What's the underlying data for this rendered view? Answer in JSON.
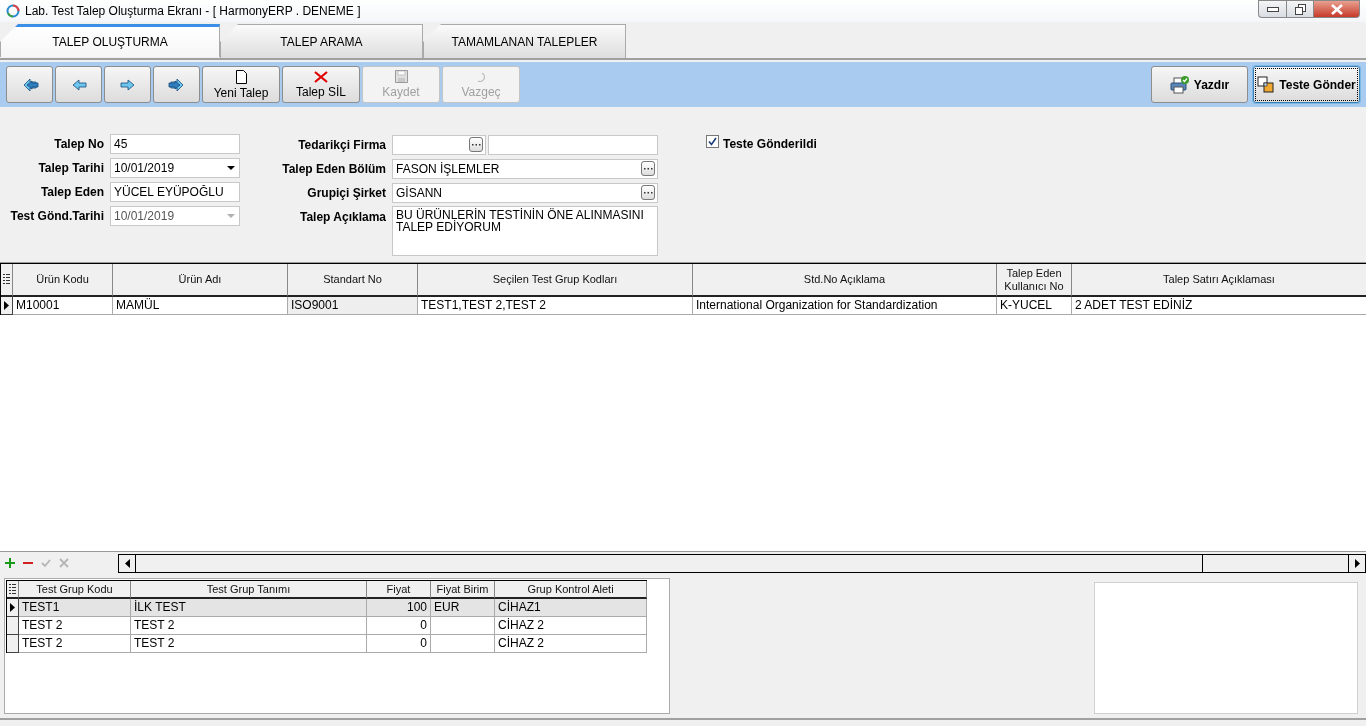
{
  "window": {
    "title": "Lab. Test Talep Oluşturma Ekranı - [ HarmonyERP . DENEME ]"
  },
  "tabs": [
    {
      "label": "TALEP OLUŞTURMA",
      "selected": true
    },
    {
      "label": "TALEP ARAMA",
      "selected": false
    },
    {
      "label": "TAMAMLANAN TALEPLER",
      "selected": false
    }
  ],
  "toolbar": {
    "buttons": [
      {
        "kind": "first",
        "disabled": false
      },
      {
        "kind": "prev",
        "disabled": false
      },
      {
        "kind": "next",
        "disabled": false
      },
      {
        "kind": "last",
        "disabled": false
      },
      {
        "kind": "new",
        "label": "Yeni Talep",
        "disabled": false
      },
      {
        "kind": "delete",
        "label": "Talep SİL",
        "disabled": false
      },
      {
        "kind": "save",
        "label": "Kaydet",
        "disabled": true
      },
      {
        "kind": "cancel",
        "label": "Vazgeç",
        "disabled": true
      }
    ],
    "right_buttons": [
      {
        "kind": "print",
        "label": "Yazdır",
        "focused": false
      },
      {
        "kind": "send",
        "label": "Teste Gönder",
        "focused": true
      }
    ]
  },
  "form": {
    "left_fields": [
      {
        "kind": "text",
        "label": "Talep No",
        "value": "45"
      },
      {
        "kind": "date",
        "label": "Talep Tarihi",
        "value": "10/01/2019",
        "disabled": false
      },
      {
        "kind": "text",
        "label": "Talep Eden",
        "value": "YÜCEL EYÜPOĞLU"
      },
      {
        "kind": "date",
        "label": "Test Gönd.Tarihi",
        "value": "10/01/2019",
        "disabled": true
      }
    ],
    "right_fields": [
      {
        "kind": "split_lookup",
        "label": "Tedarikçi Firma"
      },
      {
        "kind": "lookup",
        "label": "Talep Eden Bölüm",
        "value": "FASON İŞLEMLER"
      },
      {
        "kind": "lookup",
        "label": "Grupiçi Şirket",
        "value": "GİSANN"
      },
      {
        "kind": "memo",
        "label": "Talep Açıklama",
        "value": "BU ÜRÜNLERİN TESTİNİN ÖNE ALINMASINI TALEP EDİYORUM"
      }
    ],
    "checkbox": {
      "label": "Teste Gönderildi",
      "checked": true
    }
  },
  "grid1": {
    "columns": [
      {
        "label": "Ürün Kodu",
        "shaded": false
      },
      {
        "label": "Ürün Adı",
        "shaded": false
      },
      {
        "label": "Standart No",
        "shaded": true
      },
      {
        "label": "Seçilen Test Grup Kodları",
        "shaded": false
      },
      {
        "label": "Std.No Açıklama",
        "shaded": false
      },
      {
        "label": "Talep Eden Kullanıcı No",
        "shaded": false
      },
      {
        "label": "Talep Satırı Açıklaması",
        "shaded": false
      }
    ],
    "rows": [
      {
        "current": true,
        "selected": false,
        "cells": [
          "M10001",
          "MAMÜL",
          "ISO9001",
          "TEST1,TEST 2,TEST 2",
          "International Organization for Standardization",
          "K-YUCEL",
          "2 ADET  TEST EDİNİZ"
        ]
      }
    ]
  },
  "grid_nav": [
    {
      "kind": "add",
      "disabled": false
    },
    {
      "kind": "remove",
      "disabled": false
    },
    {
      "kind": "confirm",
      "disabled": true
    },
    {
      "kind": "cancel",
      "disabled": true
    }
  ],
  "grid2": {
    "columns": [
      {
        "label": "Test Grup Kodu"
      },
      {
        "label": "Test Grup Tanımı"
      },
      {
        "label": "Fiyat"
      },
      {
        "label": "Fiyat Birim"
      },
      {
        "label": "Grup Kontrol Aleti"
      }
    ],
    "rows": [
      {
        "current": true,
        "selected": true,
        "cells": [
          "TEST1",
          "İLK TEST",
          "100",
          "EUR",
          "CİHAZ1"
        ]
      },
      {
        "current": false,
        "selected": false,
        "cells": [
          "TEST 2",
          "TEST 2",
          "0",
          null,
          "CİHAZ 2"
        ]
      },
      {
        "current": false,
        "selected": false,
        "cells": [
          "TEST 2",
          "TEST 2",
          "0",
          null,
          "CİHAZ 2"
        ]
      }
    ]
  }
}
